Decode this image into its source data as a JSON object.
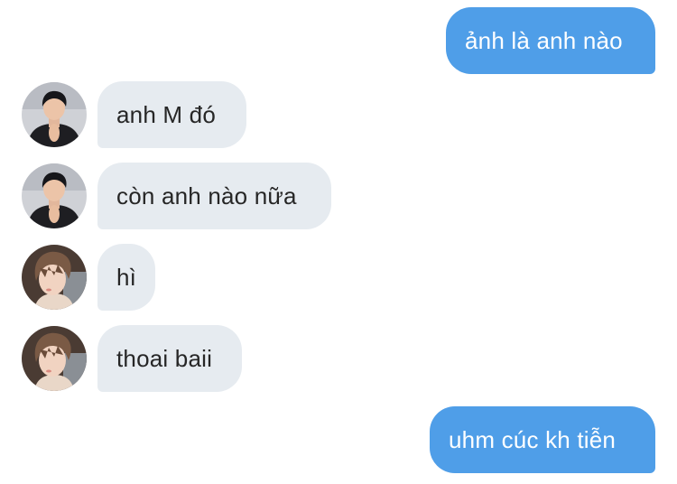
{
  "messages": [
    {
      "direction": "out",
      "text": "ảnh là anh nào"
    },
    {
      "direction": "in",
      "sender_avatar": "avatar-dark-hair-man",
      "text": "anh M đó"
    },
    {
      "direction": "in",
      "sender_avatar": "avatar-dark-hair-man",
      "text": "còn anh nào nữa"
    },
    {
      "direction": "in",
      "sender_avatar": "avatar-brown-hair-man",
      "text": "hì"
    },
    {
      "direction": "in",
      "sender_avatar": "avatar-brown-hair-man",
      "text": "thoai baii"
    },
    {
      "direction": "out",
      "text": "uhm cúc kh tiễn"
    }
  ],
  "colors": {
    "outgoing_bubble": "#4f9ee8",
    "outgoing_text": "#ffffff",
    "incoming_bubble": "#e6ebf0",
    "incoming_text": "#262626",
    "background": "#ffffff"
  }
}
